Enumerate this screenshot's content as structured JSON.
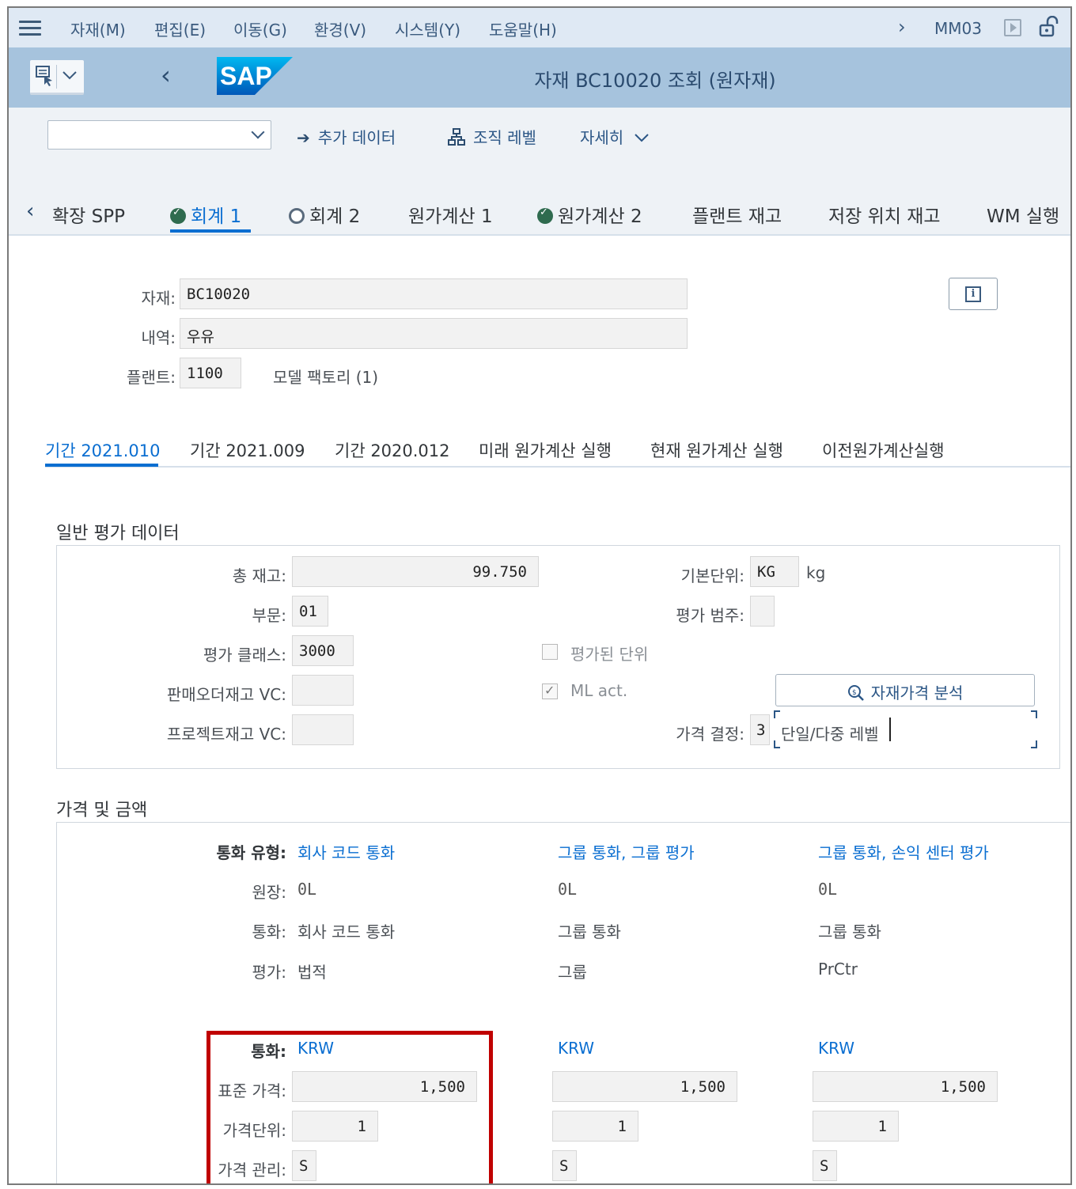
{
  "menu": {
    "items": [
      "자재(M)",
      "편집(E)",
      "이동(G)",
      "환경(V)",
      "시스템(Y)",
      "도움말(H)"
    ],
    "tcode": "MM03"
  },
  "titlebar": {
    "logo": "SAP",
    "title": "자재 BC10020 조회 (원자재)"
  },
  "toolbar": {
    "select_value": "",
    "additional_data": "추가 데이터",
    "org_levels": "조직 레벨",
    "more": "자세히"
  },
  "object_tabs": [
    "확장 SPP",
    "회계 1",
    "회계 2",
    "원가계산 1",
    "원가계산 2",
    "플랜트 재고",
    "저장 위치 재고",
    "WM 실행"
  ],
  "header": {
    "material_label": "자재:",
    "material_value": "BC10020",
    "desc_label": "내역:",
    "desc_value": "우유",
    "plant_label": "플랜트:",
    "plant_value": "1100",
    "plant_name": "모델 팩토리 (1)"
  },
  "period_tabs": [
    "기간 2021.010",
    "기간 2021.009",
    "기간 2020.012",
    "미래 원가계산 실행",
    "현재 원가계산 실행",
    "이전원가계산실행"
  ],
  "general": {
    "title": "일반 평가 데이터",
    "total_stock_label": "총 재고:",
    "total_stock_value": "99.750",
    "base_unit_label": "기본단위:",
    "base_unit_value": "KG",
    "base_unit_text": "kg",
    "division_label": "부문:",
    "division_value": "01",
    "valuation_cat_label": "평가 범주:",
    "valuation_cat_value": "",
    "valuation_class_label": "평가 클래스:",
    "valuation_class_value": "3000",
    "valuated_unit_label": "평가된 단위",
    "so_stock_label": "판매오더재고 VC:",
    "so_stock_value": "",
    "ml_act_label": "ML act.",
    "price_analysis_button": "자재가격 분석",
    "project_stock_label": "프로젝트재고 VC:",
    "project_stock_value": "",
    "price_det_label": "가격 결정:",
    "price_det_value": "3",
    "price_det_text": "단일/다중 레벨"
  },
  "prices": {
    "title": "가격 및 금액",
    "currency_type_label": "통화 유형:",
    "ledger_label": "원장:",
    "currency_label": "통화:",
    "valuation_label": "평가:",
    "currency_code_label": "통화:",
    "std_price_label": "표준 가격:",
    "price_unit_label": "가격단위:",
    "price_control_label": "가격 관리:",
    "columns": [
      {
        "currency_type": "회사 코드 통화",
        "ledger": "0L",
        "currency": "회사 코드 통화",
        "valuation": "법적",
        "currency_code": "KRW",
        "std_price": "1,500",
        "price_unit": "1",
        "price_control": "S"
      },
      {
        "currency_type": "그룹 통화, 그룹 평가",
        "ledger": "0L",
        "currency": "그룹 통화",
        "valuation": "그룹",
        "currency_code": "KRW",
        "std_price": "1,500",
        "price_unit": "1",
        "price_control": "S"
      },
      {
        "currency_type": "그룹 통화, 손익 센터 평가",
        "ledger": "0L",
        "currency": "그룹 통화",
        "valuation": "PrCtr",
        "currency_code": "KRW",
        "std_price": "1,500",
        "price_unit": "1",
        "price_control": "S"
      }
    ]
  },
  "colors": {
    "menubar_bg": "#dfe9f4",
    "titlebar_bg": "#a6c3dd",
    "accent": "#0a6ed1",
    "highlight_box": "#c00000"
  }
}
